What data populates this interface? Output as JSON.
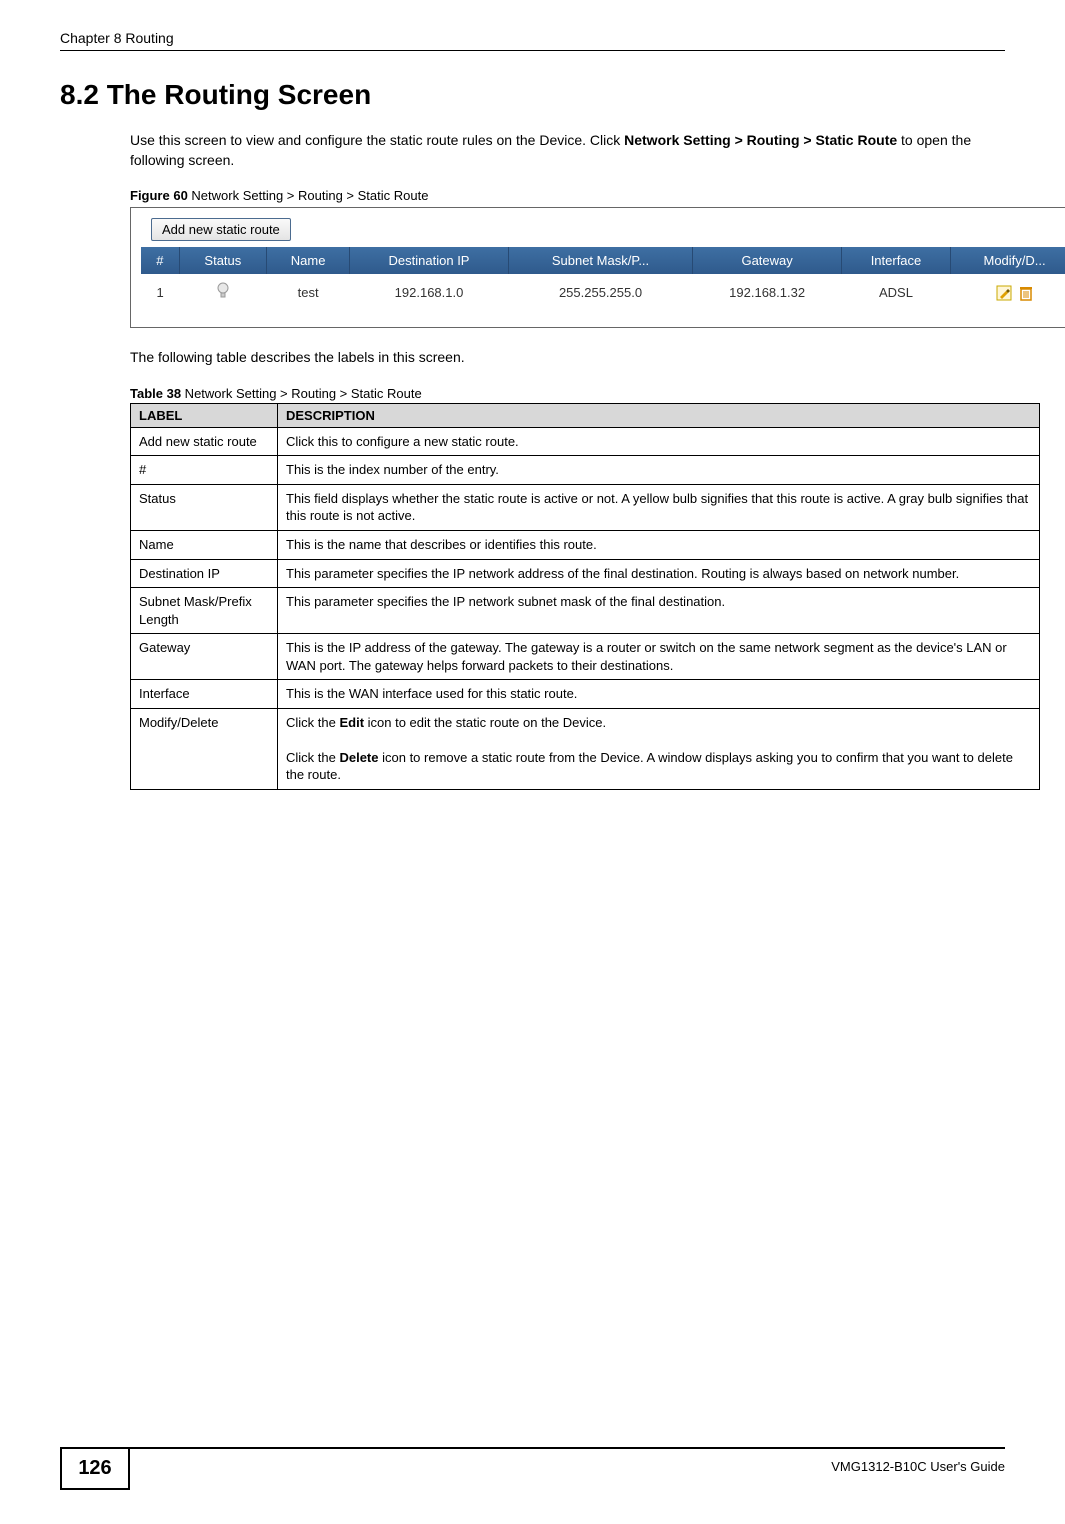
{
  "header": {
    "chapter": "Chapter 8 Routing"
  },
  "section": {
    "title": "8.2  The Routing Screen",
    "intro_part1": "Use this screen to view and configure the static route rules on the Device. Click ",
    "intro_nav": "Network Setting > Routing > Static Route",
    "intro_part2": " to open the following screen.",
    "following_table": "The following table describes the labels in this screen."
  },
  "figure60": {
    "label": "Figure 60",
    "caption": "   Network Setting > Routing > Static Route",
    "add_button": "Add new static route",
    "columns": [
      "#",
      "Status",
      "Name",
      "Destination IP",
      "Subnet Mask/P...",
      "Gateway",
      "Interface",
      "Modify/D..."
    ],
    "row1": {
      "index": "1",
      "status_icon": "bulb-off-icon",
      "name": "test",
      "dest_ip": "192.168.1.0",
      "subnet": "255.255.255.0",
      "gateway": "192.168.1.32",
      "interface": "ADSL"
    }
  },
  "table38": {
    "label": "Table 38",
    "caption": "   Network Setting > Routing > Static Route",
    "head_label": "LABEL",
    "head_desc": "DESCRIPTION",
    "rows": [
      {
        "label": "Add new static route",
        "desc": "Click this to configure a new static route."
      },
      {
        "label": "#",
        "desc": "This is the index number of the entry."
      },
      {
        "label": "Status",
        "desc": "This field displays whether the static route is active or not. A yellow bulb signifies that this route is active. A gray bulb signifies that this route is not active."
      },
      {
        "label": "Name",
        "desc": "This is the name that describes or identifies this route."
      },
      {
        "label": "Destination IP",
        "desc": "This parameter specifies the IP network address of the final destination. Routing is always based on network number."
      },
      {
        "label": "Subnet Mask/Prefix Length",
        "desc": "This parameter specifies the IP network subnet mask of the final destination."
      },
      {
        "label": "Gateway",
        "desc": "This is the IP address of the gateway. The gateway is a router or switch on the same network segment as the device's LAN or WAN port. The gateway helps forward packets to their destinations."
      },
      {
        "label": "Interface",
        "desc": "This is the WAN interface used for this static route."
      }
    ],
    "modify_row": {
      "label": "Modify/Delete",
      "part1": "Click the ",
      "edit_word": "Edit",
      "part2": " icon to edit the static route on the Device.",
      "part3": "Click the ",
      "delete_word": "Delete",
      "part4": " icon to remove a static route from the Device. A window displays asking you to confirm that you want to delete the route."
    }
  },
  "footer": {
    "page_number": "126",
    "guide": "VMG1312-B10C User's Guide"
  }
}
